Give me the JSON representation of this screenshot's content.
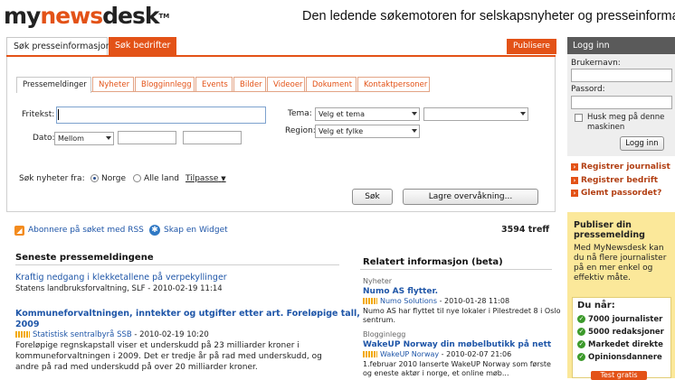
{
  "header": {
    "logo": {
      "my": "my",
      "news": "news",
      "desk": "desk",
      "tm": "TM"
    },
    "tagline": "Den ledende søkemotoren for selskapsnyheter og presseinformasjon"
  },
  "top_tabs": [
    {
      "label": "Søk presseinformasjon",
      "active": true
    },
    {
      "label": "Søk bedrifter",
      "active": false
    }
  ],
  "publish_button": "Publisere",
  "sub_tabs": [
    "Pressemeldinger",
    "Nyheter",
    "Blogginnlegg",
    "Events",
    "Bilder",
    "Videoer",
    "Dokument",
    "Kontaktpersoner"
  ],
  "search": {
    "fritekst_label": "Fritekst:",
    "fritekst_value": "",
    "dato_label": "Dato:",
    "dato_value": "Mellom",
    "tema_label": "Tema:",
    "tema_value": "Velg et tema",
    "region_label": "Region:",
    "region_value": "Velg et fylke",
    "search_from_label": "Søk nyheter fra:",
    "radio_norway": "Norge",
    "radio_all": "Alle land",
    "customize_link": "Tilpasse",
    "search_button": "Søk",
    "save_watch_button": "Lagre overvåkning..."
  },
  "actions": {
    "subscribe_rss": "Abonnere på søket med RSS",
    "create_widget": "Skap en Widget",
    "hits": "3594 treff"
  },
  "latest": {
    "heading": "Seneste pressemeldingene",
    "items": [
      {
        "title": "Kraftig nedgang i klekketallene på verpekyllinger",
        "meta": "Statens landbruksforvaltning, SLF - 2010-02-19 11:14"
      },
      {
        "title_line1": "Kommuneforvaltningen, inntekter og utgifter etter art. Foreløpige tall,",
        "title_line2": "2009",
        "source": "Statistisk sentralbyrå SSB",
        "date": " - 2010-02-19 10:20",
        "body_line1": "Foreløpige regnskapstall viser et underskudd på 23 milliarder kroner i",
        "body_line2": "kommuneforvaltningen i 2009. Det er tredje år på rad med underskudd, og",
        "body_line3": "andre på rad med underskudd på over 20 milliarder kroner."
      }
    ]
  },
  "related": {
    "heading": "Relatert informasjon (beta)",
    "groups": [
      {
        "category": "Nyheter",
        "title": "Numo AS flytter.",
        "source": "Numo Solutions",
        "date": " - 2010-01-28 11:08",
        "body_line1": "Numo AS har flyttet til nye lokaler i Pilestredet 8 i Oslo",
        "body_line2": "sentrum."
      },
      {
        "category": "Blogginlegg",
        "title": "WakeUP Norway din møbelbutikk på nett",
        "source": "WakeUP Norway",
        "date": " - 2010-02-07 21:06",
        "body_line1": "1.februar 2010 lanserte WakeUP Norway som første",
        "body_line2": "og eneste aktør i norge, et online møb..."
      }
    ]
  },
  "login": {
    "title": "Logg inn",
    "username_label": "Brukernavn:",
    "password_label": "Passord:",
    "remember_line1": "Husk meg på denne",
    "remember_line2": "maskinen",
    "login_button": "Logg inn",
    "links": [
      "Registrer journalist",
      "Registrer bedrift",
      "Glemt passordet?"
    ]
  },
  "promo": {
    "title_line1": "Publiser din",
    "title_line2": "pressemelding",
    "text_line1": "Med MyNewsdesk kan",
    "text_line2": "du nå flere journalister",
    "text_line3": "på en mer enkel og",
    "text_line4": "effektiv måte.",
    "dunar_heading": "Du når:",
    "dunar_items": [
      "7000 journalister",
      "5000 redaksjoner",
      "Markedet direkte",
      "Opinionsdannere"
    ],
    "test_button": "Test gratis"
  },
  "colors": {
    "brand": "#e35217",
    "link": "#1f56a8",
    "promo_bg": "#fbe89a",
    "login_header": "#5a5a5a"
  }
}
